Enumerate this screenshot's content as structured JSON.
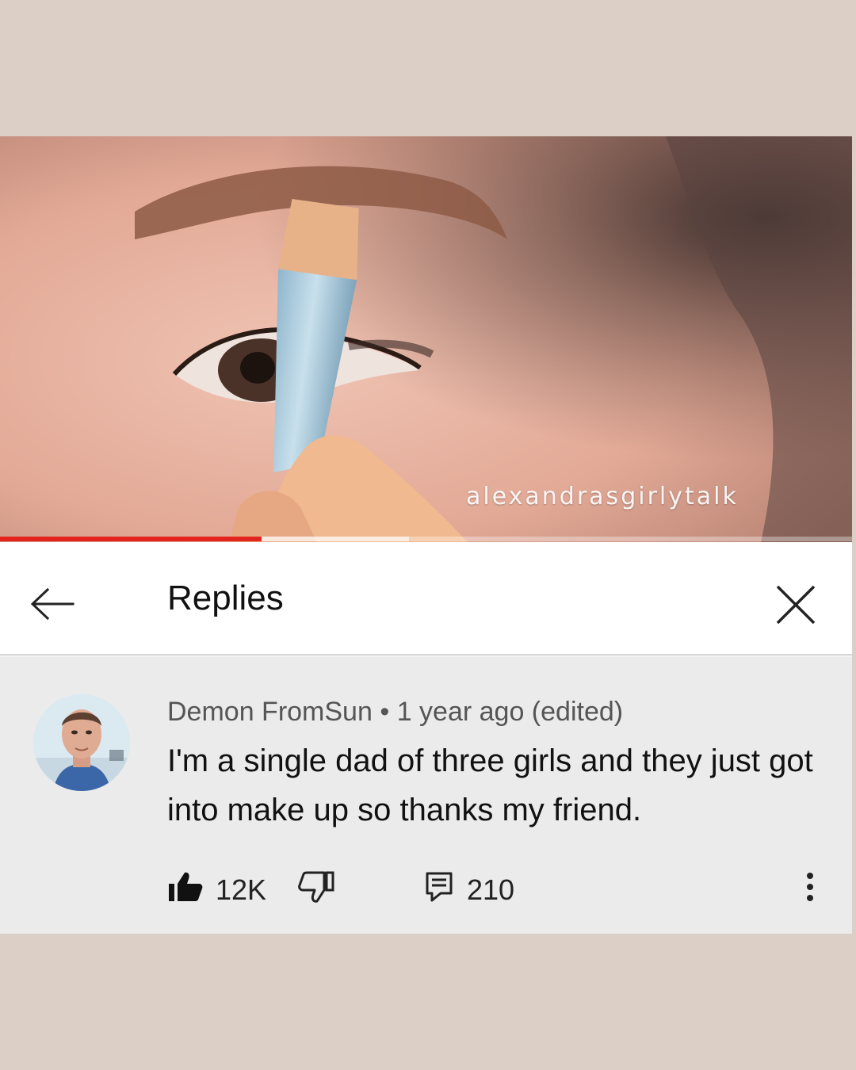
{
  "video": {
    "watermark": "alexandrasgirlytalk",
    "progress_fraction": 0.307,
    "progress_color": "#e3231e"
  },
  "header": {
    "back_icon": "arrow-left-icon",
    "title": "Replies",
    "close_icon": "close-icon"
  },
  "comment": {
    "author": "Demon FromSun",
    "separator": "•",
    "time": "1 year ago (edited)",
    "text": "I'm a single dad of three girls and they just got into make up so thanks my friend.",
    "likes": "12K",
    "replies": "210",
    "icons": [
      "thumbs-up-icon",
      "thumbs-down-icon",
      "reply-icon",
      "more-vertical-icon"
    ]
  },
  "colors": {
    "page_background": "#dccfc6",
    "comment_background": "#ebebeb",
    "header_background": "#ffffff"
  }
}
